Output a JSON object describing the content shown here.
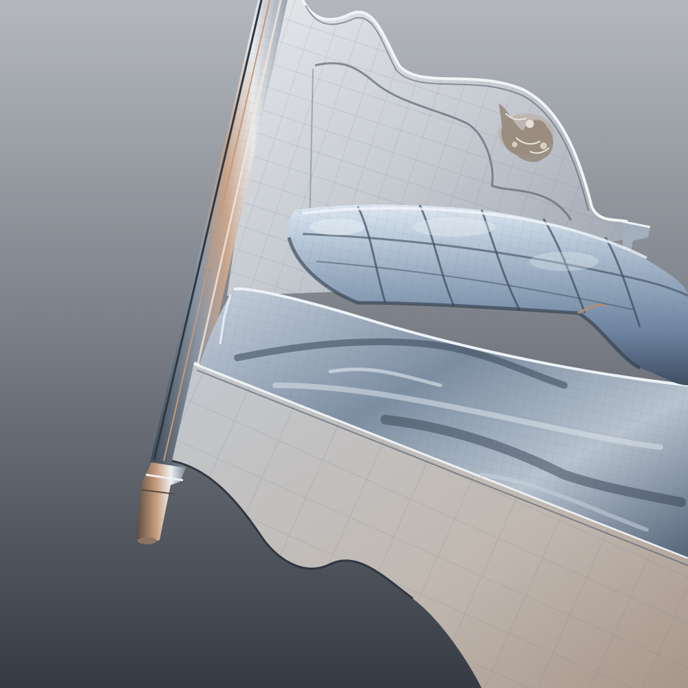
{
  "scene": {
    "subject": "bed-3d-wireframe-render",
    "colors": {
      "background_top": "#a8acb2",
      "background_bottom": "#3a3f47",
      "metal_light": "#d9e2ea",
      "metal_mid": "#8e9db0",
      "metal_dark": "#3c4a5a",
      "wood_light": "#c9ccd0",
      "wood_warm": "#b7a79a",
      "wireline": "#6c7480"
    }
  }
}
